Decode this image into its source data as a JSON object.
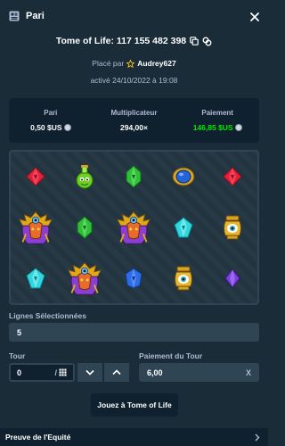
{
  "header": {
    "title": "Pari"
  },
  "game": {
    "name_and_id": "Tome of Life: 117 155 482 398"
  },
  "placed_by": {
    "prefix": "Placé par",
    "user": "Audrey627"
  },
  "date": "activé 24/10/2022 à 19:08",
  "stats": {
    "bet_label": "Pari",
    "bet_value": "0,50 $US",
    "multiplier_label": "Multiplicateur",
    "multiplier_value": "294,00×",
    "payout_label": "Paiement",
    "payout_value": "146,85 $US",
    "payout_color": "#00e701"
  },
  "board": {
    "rows": [
      [
        "red-gem",
        "green-potion",
        "green-gem",
        "blue-amulet",
        "red-gem"
      ],
      [
        "pharaoh",
        "green-gem",
        "pharaoh",
        "cyan-gem",
        "eye-urn"
      ],
      [
        "cyan-gem",
        "pharaoh",
        "blue-gem",
        "eye-urn",
        "purple-gem"
      ]
    ]
  },
  "lines": {
    "label": "Lignes Sélectionnées",
    "value": "5"
  },
  "round": {
    "label": "Tour",
    "value": "0",
    "separator": "/"
  },
  "round_payout": {
    "label": "Paiement du Tour",
    "value": "6,00",
    "suffix": "X"
  },
  "play_button": "Jouez à Tome of Life",
  "footer": {
    "label": "Preuve de l'Equité"
  }
}
